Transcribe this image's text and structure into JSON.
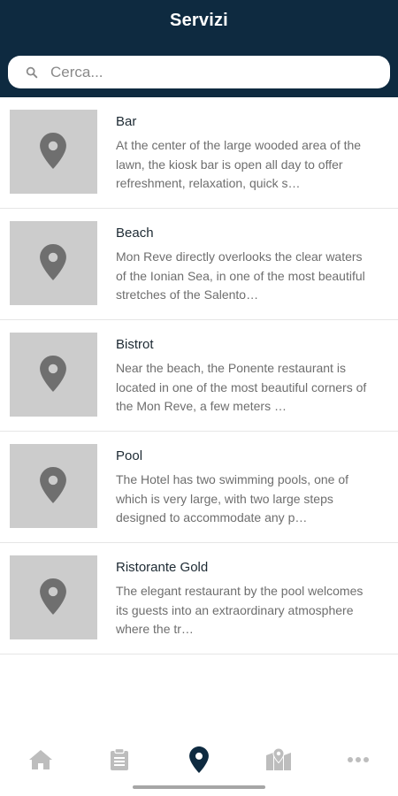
{
  "header": {
    "title": "Servizi"
  },
  "search": {
    "placeholder": "Cerca..."
  },
  "items": [
    {
      "title": "Bar",
      "description": "At the center of the large wooded area of the lawn, the kiosk bar is open all day to offer refreshment, relaxation, quick s…"
    },
    {
      "title": "Beach",
      "description": "Mon Reve directly overlooks the clear waters of the Ionian Sea, in one of the most beautiful stretches of the Salento…"
    },
    {
      "title": "Bistrot",
      "description": "Near the beach, the Ponente restaurant is located in one of the most beautiful corners of the Mon Reve, a few meters …"
    },
    {
      "title": "Pool",
      "description": "The Hotel has two swimming pools, one of which is very large, with two large steps designed to accommodate any p…"
    },
    {
      "title": "Ristorante Gold",
      "description": "The elegant restaurant by the pool welcomes its guests into an extraordinary atmosphere where the tr…"
    }
  ],
  "tabbar": {
    "tabs": [
      {
        "icon": "home-icon",
        "active": false
      },
      {
        "icon": "clipboard-icon",
        "active": false
      },
      {
        "icon": "map-pin-icon",
        "active": true
      },
      {
        "icon": "map-icon",
        "active": false
      },
      {
        "icon": "more-icon",
        "active": false
      }
    ]
  },
  "colors": {
    "header_bg": "#0e2a40",
    "thumb_bg": "#cccccc",
    "active_tab": "#0e2a40",
    "inactive_tab": "#bdbdbd"
  }
}
